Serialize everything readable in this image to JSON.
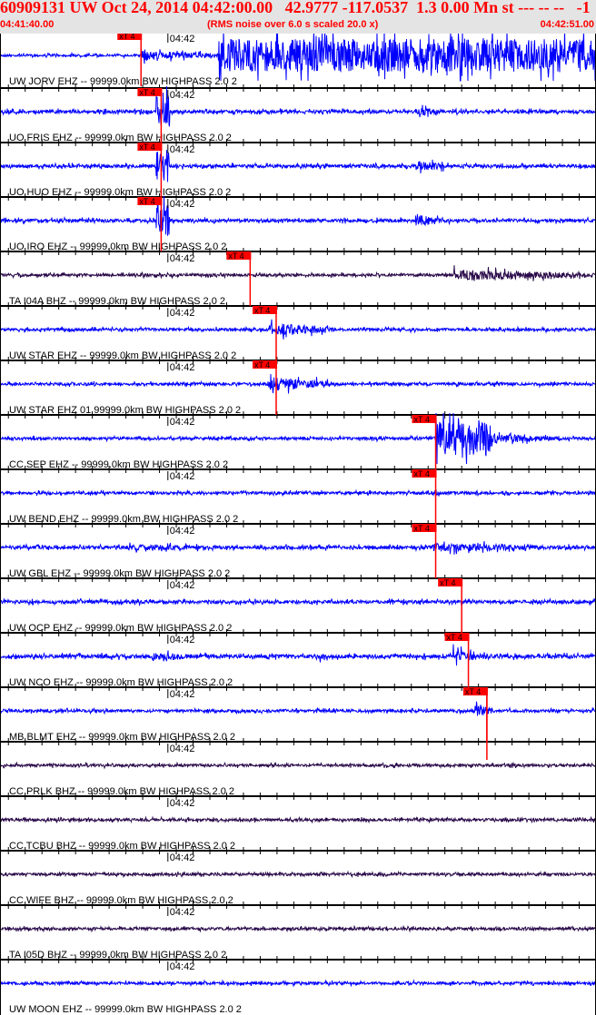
{
  "header": {
    "title": "60909131 UW Oct 24, 2014 04:42:00.00   42.9777 -117.0537  1.3 0.00 Mn st --- -- --   -1",
    "start_time": "04:41:40.00",
    "note": "(RMS noise over 6.0 s scaled 20.0 x)",
    "end_time": "04:42:51.00"
  },
  "chart_data": {
    "type": "line",
    "duration_s": 71,
    "minute_label": "04:42",
    "minute_offset_s": 20,
    "pick_label": "xT 4",
    "colors": {
      "blue": "#0000ff",
      "purple": "#2a0a4a",
      "pick": "#ff0000"
    },
    "traces": [
      {
        "label": "UW JORV EHZ -- 99999.0km BW  HIGHPASS  2.0  2",
        "color": "blue",
        "pick_s": 16.8,
        "noise": 0.08,
        "env": [
          [
            16.8,
            26,
            0.35
          ],
          [
            26,
            71,
            1.2
          ]
        ]
      },
      {
        "label": "UO FRIS EHZ -- 99999.0km BW  HIGHPASS  2.0  2",
        "color": "blue",
        "pick_s": 19.2,
        "noise": 0.12,
        "env": [
          [
            18.6,
            20.2,
            1.2
          ],
          [
            49.5,
            52.5,
            0.35
          ]
        ]
      },
      {
        "label": "UO HUO EHZ -- 99999.0km BW  HIGHPASS  2.0  2",
        "color": "blue",
        "pick_s": 19.2,
        "noise": 0.12,
        "env": [
          [
            18.6,
            20.2,
            1.2
          ],
          [
            49.5,
            54,
            0.4
          ]
        ]
      },
      {
        "label": "UO IRO EHZ -- 99999.0km BW  HIGHPASS  2.0  2",
        "color": "blue",
        "pick_s": 19.2,
        "noise": 0.12,
        "env": [
          [
            18.6,
            20.2,
            1.2
          ],
          [
            49.5,
            53,
            0.45
          ]
        ]
      },
      {
        "label": "TA I04A BHZ -- 99999.0km BW  HIGHPASS  2.0  2",
        "color": "purple",
        "pick_s": 29.8,
        "noise": 0.1,
        "env": [
          [
            54,
            71,
            0.4
          ]
        ]
      },
      {
        "label": "UW STAR EHZ -- 99999.0km BW  HIGHPASS  2.0  2",
        "color": "blue",
        "pick_s": 32.9,
        "noise": 0.1,
        "env": [
          [
            32,
            40,
            0.5
          ]
        ]
      },
      {
        "label": "UW STAR EHZ 01 99999.0km BW  HIGHPASS  2.0  2",
        "color": "blue",
        "pick_s": 32.9,
        "noise": 0.1,
        "env": [
          [
            32,
            40,
            0.55
          ]
        ]
      },
      {
        "label": "CC SEP EHZ -- 99999.0km BW  HIGHPASS  2.0  2",
        "color": "blue",
        "pick_s": 51.9,
        "noise": 0.1,
        "env": [
          [
            51.9,
            58.5,
            1.2
          ],
          [
            58.5,
            67,
            0.35
          ]
        ]
      },
      {
        "label": "UW BEND EHZ -- 99999.0km BW  HIGHPASS  2.0  2",
        "color": "blue",
        "pick_s": 51.9,
        "noise": 0.1,
        "env": [
          [
            51,
            55,
            0.2
          ]
        ]
      },
      {
        "label": "UW GBL EHZ -- 99999.0km BW  HIGHPASS  2.0  2",
        "color": "blue",
        "pick_s": 51.9,
        "noise": 0.12,
        "env": [
          [
            15,
            33,
            0.22
          ],
          [
            51.5,
            71,
            0.3
          ]
        ]
      },
      {
        "label": "UW OCP EHZ -- 99999.0km BW  HIGHPASS  2.0  2",
        "color": "blue",
        "pick_s": 55,
        "noise": 0.12,
        "env": []
      },
      {
        "label": "UW NCO EHZ -- 99999.0km BW  HIGHPASS  2.0  2",
        "color": "blue",
        "pick_s": 55.8,
        "noise": 0.14,
        "env": [
          [
            18,
            23,
            0.4
          ],
          [
            54,
            58,
            0.45
          ],
          [
            38,
            41,
            0.25
          ]
        ]
      },
      {
        "label": "MB BLMT EHZ -- 99999.0km BW  HIGHPASS  2.0  2",
        "color": "blue",
        "pick_s": 58,
        "noise": 0.1,
        "env": [
          [
            56.5,
            59,
            0.45
          ]
        ]
      },
      {
        "label": "CC PRLK BHZ -- 99999.0km BW  HIGHPASS  2.0  2",
        "color": "purple",
        "pick_s": null,
        "noise": 0.1,
        "env": []
      },
      {
        "label": "CC TCBU BHZ -- 99999.0km BW  HIGHPASS  2.0  2",
        "color": "purple",
        "pick_s": null,
        "noise": 0.1,
        "env": []
      },
      {
        "label": "CC WIFE BHZ -- 99999.0km BW  HIGHPASS  2.0  2",
        "color": "purple",
        "pick_s": null,
        "noise": 0.1,
        "env": []
      },
      {
        "label": "TA I05D BHZ -- 99999.0km BW  HIGHPASS  2.0  2",
        "color": "purple",
        "pick_s": null,
        "noise": 0.1,
        "env": []
      },
      {
        "label": "UW MOON EHZ -- 99999.0km BW  HIGHPASS  2.0  2",
        "color": "blue",
        "pick_s": null,
        "noise": 0.1,
        "env": []
      }
    ]
  }
}
